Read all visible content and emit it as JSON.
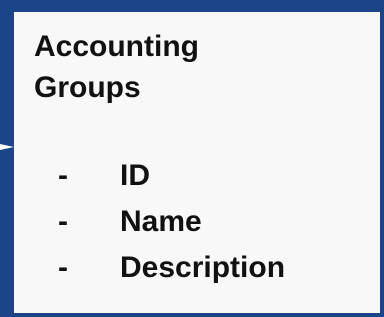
{
  "entity": {
    "title_line1": "Accounting",
    "title_line2": "Groups",
    "fields": [
      {
        "bullet": "-",
        "label": "ID"
      },
      {
        "bullet": "-",
        "label": "Name"
      },
      {
        "bullet": "-",
        "label": "Description"
      }
    ]
  },
  "colors": {
    "background": "#1b4588",
    "card": "#f8f8f8",
    "text": "#111111",
    "connector": "#ffffff"
  },
  "icons": {
    "connector": "arrow-right-icon"
  }
}
